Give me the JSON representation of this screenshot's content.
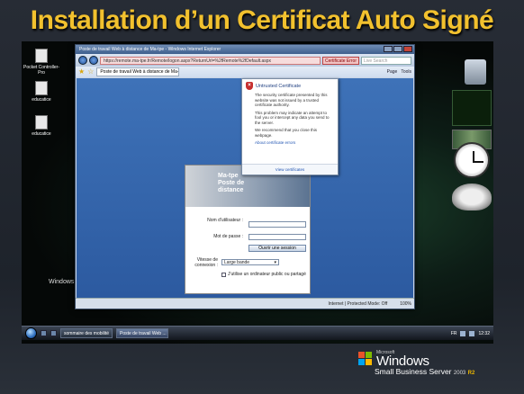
{
  "slide": {
    "title": "Installation d’un Certificat Auto Signé"
  },
  "desktop": {
    "icons": [
      {
        "label": "Pocket Controller-Pro"
      },
      {
        "label": "educatice"
      },
      {
        "label": "educatice"
      }
    ],
    "os_logo": "Windows"
  },
  "browser": {
    "title": "Poste de travail Web à distance de Ma-tpe - Windows Internet Explorer",
    "address": "https://remote.ma-tpe.fr/Remote/logon.aspx?ReturnUrl=%2fRemote%2fDefault.aspx",
    "cert_error_label": "Certificate Error",
    "search_placeholder": "Live Search",
    "tab_label": "Poste de travail Web à distance de Ma-...",
    "toolbar": {
      "page_label": "Page",
      "tools_label": "Tools"
    },
    "status": {
      "zone": "Internet | Protected Mode: Off",
      "zoom": "100%"
    }
  },
  "login": {
    "header_line1": "Ma-tpe",
    "header_line2": "Poste de",
    "header_line3": "distance",
    "username_label": "Nom d'utilisateur :",
    "password_label": "Mot de passe :",
    "open_button": "Ouvrir une session",
    "speed_label": "Vitesse de connexion :",
    "speed_value": "Large bande",
    "public_checkbox_label": "J'utilise un ordinateur public ou partagé"
  },
  "cert_popup": {
    "title": "Untrusted Certificate",
    "para1": "The security certificate presented by this website was not issued by a trusted certificate authority.",
    "para2": "This problem may indicate an attempt to fool you or intercept any data you send to the server.",
    "para3": "We recommend that you close this webpage.",
    "link": "About certificate errors",
    "view_button": "View certificates"
  },
  "taskbar": {
    "tasks": [
      {
        "label": "sommaire des mobilité"
      },
      {
        "label": "Poste de travail Web ..."
      }
    ],
    "lang": "FR",
    "time": "12:32"
  },
  "branding": {
    "microsoft": "Microsoft",
    "windows": "Windows",
    "sbs": "Small Business Server",
    "version": "2003",
    "r2": "R2"
  },
  "colors": {
    "title_gold": "#f2c12e",
    "ie_blue": "#3e72b8",
    "cert_red": "#c62f2f"
  }
}
